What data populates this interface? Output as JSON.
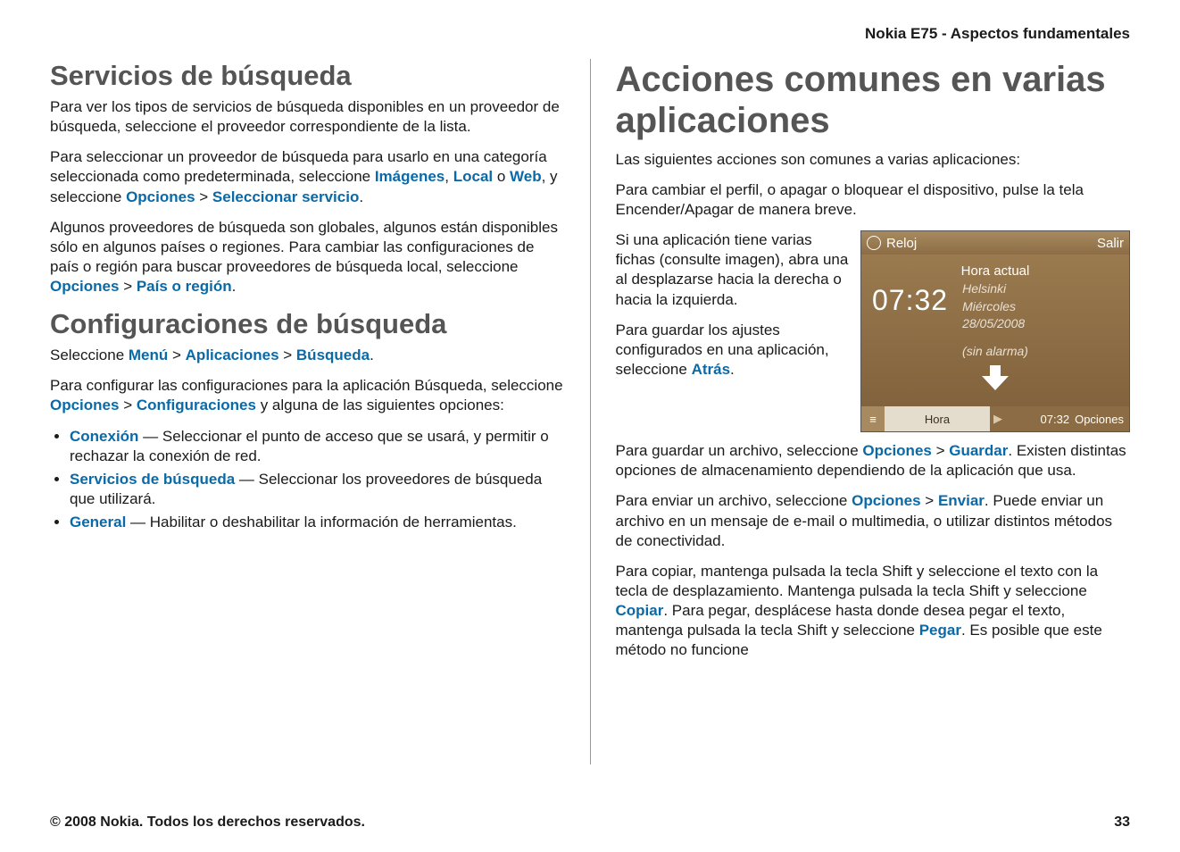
{
  "header": "Nokia E75 - Aspectos fundamentales",
  "footer": {
    "copyright": "© 2008 Nokia. Todos los derechos reservados.",
    "page": "33"
  },
  "left": {
    "h1": "Servicios de búsqueda",
    "p1": "Para ver los tipos de servicios de búsqueda disponibles en un proveedor de búsqueda, seleccione el proveedor correspondiente de la lista.",
    "p2a": "Para seleccionar un proveedor de búsqueda para usarlo en una categoría seleccionada como predeterminada, seleccione ",
    "p2_im": "Imágenes",
    "p2_sep1": ", ",
    "p2_loc": "Local",
    "p2_sep2": " o ",
    "p2_web": "Web",
    "p2b": ", y seleccione ",
    "p2_opc": "Opciones",
    "p2_gt": " > ",
    "p2_sel": "Seleccionar servicio",
    "p2_dot": ".",
    "p3a": "Algunos proveedores de búsqueda son globales, algunos están disponibles sólo en algunos países o regiones. Para cambiar las configuraciones de país o región para buscar proveedores de búsqueda local, seleccione ",
    "p3_opc": "Opciones",
    "p3_gt": " > ",
    "p3_pais": "País o región",
    "p3_dot": ".",
    "h2": "Configuraciones de búsqueda",
    "p4a": "Seleccione ",
    "p4_menu": "Menú",
    "p4_gt1": " > ",
    "p4_apps": "Aplicaciones",
    "p4_gt2": " > ",
    "p4_bus": "Búsqueda",
    "p4_dot": ".",
    "p5a": "Para configurar las configuraciones para la aplicación Búsqueda, seleccione ",
    "p5_opc": "Opciones",
    "p5_gt": " > ",
    "p5_conf": "Configuraciones",
    "p5b": " y alguna de las siguientes opciones:",
    "bullets": [
      {
        "term": "Conexión",
        "text": " — Seleccionar el punto de acceso que se usará, y permitir o rechazar la conexión de red."
      },
      {
        "term": "Servicios de búsqueda",
        "text": " — Seleccionar los proveedores de búsqueda que utilizará."
      },
      {
        "term": "General",
        "text": " — Habilitar o deshabilitar la información de herramientas."
      }
    ]
  },
  "right": {
    "h1": "Acciones comunes en varias aplicaciones",
    "p1": "Las siguientes acciones son comunes a varias aplicaciones:",
    "p2": "Para cambiar el perfil, o apagar o bloquear el dispositivo, pulse la tela Encender/Apagar de manera breve.",
    "p3": "Si una aplicación tiene varias fichas (consulte imagen), abra una al desplazarse hacia la derecha o hacia la izquierda.",
    "p4a": "Para guardar los ajustes configurados en una aplicación, seleccione ",
    "p4_atras": "Atrás",
    "p4_dot": ".",
    "p5a": "Para guardar un archivo, seleccione ",
    "p5_opc": "Opciones",
    "p5_gt": " > ",
    "p5_g": "Guardar",
    "p5b": ". Existen distintas opciones de almacenamiento dependiendo de la aplicación que usa.",
    "p6a": "Para enviar un archivo, seleccione ",
    "p6_opc": "Opciones",
    "p6_gt": " > ",
    "p6_e": "Enviar",
    "p6b": ". Puede enviar un archivo en un mensaje de e-mail o multimedia, o utilizar distintos métodos de conectividad.",
    "p7a": "Para copiar, mantenga pulsada la tecla Shift y seleccione el texto con la tecla de desplazamiento. Mantenga pulsada la tecla Shift y seleccione ",
    "p7_cop": "Copiar",
    "p7b": ". Para pegar, desplácese hasta donde desea pegar el texto, mantenga pulsada la tecla Shift y seleccione ",
    "p7_peg": "Pegar",
    "p7c": ". Es posible que este método no funcione"
  },
  "phone": {
    "title": "Reloj",
    "exit": "Salir",
    "hora_actual": "Hora actual",
    "time": "07:32",
    "city": "Helsinki",
    "day": "Miércoles",
    "date": "28/05/2008",
    "alarm": "(sin alarma)",
    "tab_hora": "Hora",
    "tab_time": "07:32",
    "tab_opc": "Opciones"
  }
}
